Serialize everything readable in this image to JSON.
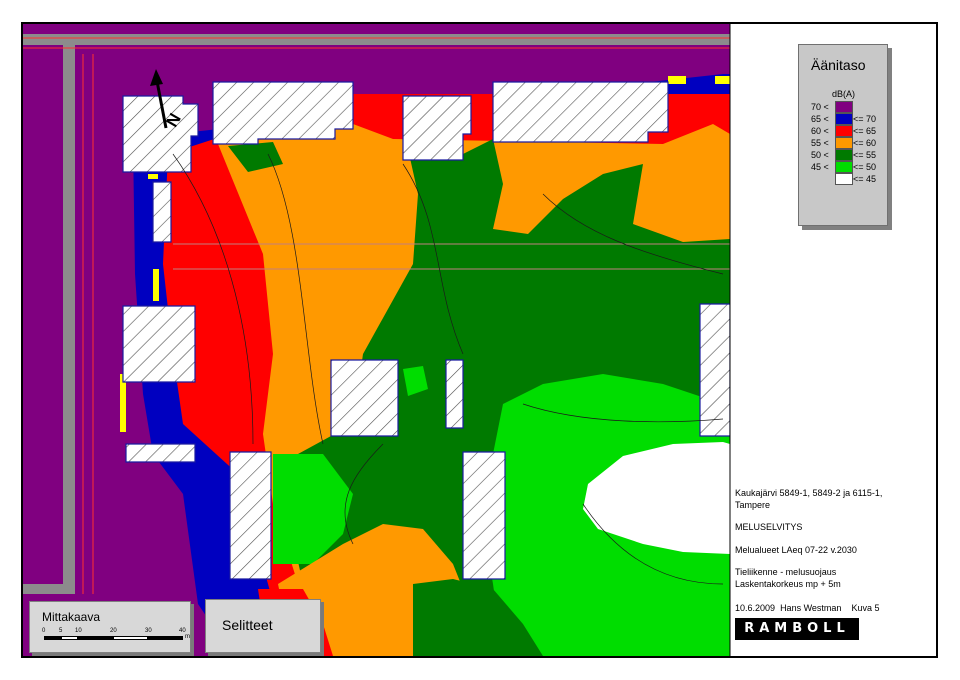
{
  "legend": {
    "title": "Äänitaso",
    "unit": "dB(A)",
    "classes": [
      {
        "lo": "70 <",
        "hi": "",
        "color": "#800080"
      },
      {
        "lo": "65 <",
        "hi": "<= 70",
        "color": "#0000c0"
      },
      {
        "lo": "60 <",
        "hi": "<= 65",
        "color": "#ff0000"
      },
      {
        "lo": "55 <",
        "hi": "<= 60",
        "color": "#ff9900"
      },
      {
        "lo": "50 <",
        "hi": "<= 55",
        "color": "#007a00"
      },
      {
        "lo": "45 <",
        "hi": "<= 50",
        "color": "#00dd00"
      },
      {
        "lo": "",
        "hi": "<= 45",
        "color": "#ffffff"
      }
    ]
  },
  "info": {
    "location": "Kaukajärvi 5849-1, 5849-2 ja 6115-1,",
    "location2": "Tampere",
    "study": "MELUSELVITYS",
    "scenario": "Melualueet LAeq 07-22 v.2030",
    "traffic": "Tieliikenne - melusuojaus",
    "height": "Laskentakorkeus mp + 5m",
    "date": "10.6.2009",
    "author": "Hans Westman",
    "figure": "Kuva 5"
  },
  "logo": "RAMBOLL",
  "scale": {
    "title": "Mittakaava",
    "ticks": [
      "0",
      "5",
      "10",
      "20",
      "30",
      "40"
    ],
    "unit": "m"
  },
  "selitteet": "Selitteet",
  "north": "N"
}
